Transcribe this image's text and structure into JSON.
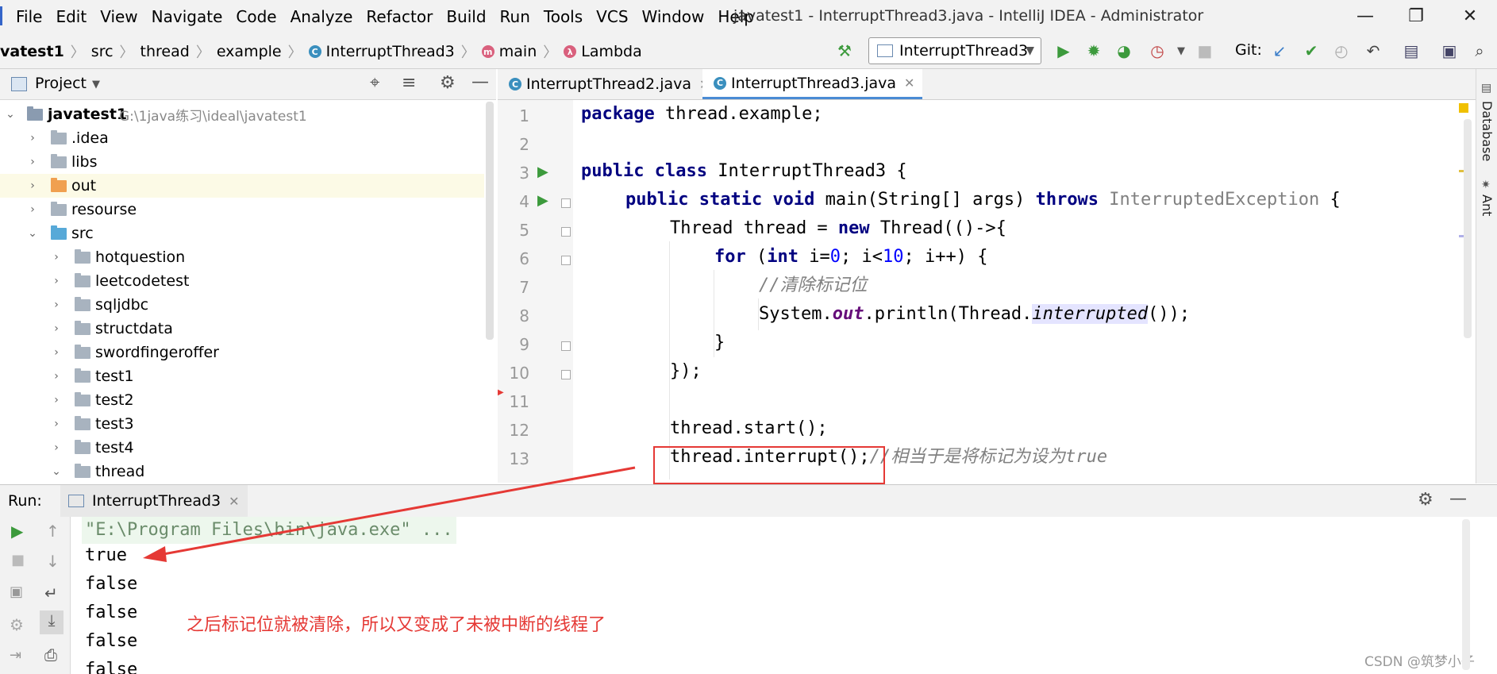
{
  "menu": [
    "File",
    "Edit",
    "View",
    "Navigate",
    "Code",
    "Analyze",
    "Refactor",
    "Build",
    "Run",
    "Tools",
    "VCS",
    "Window",
    "Help"
  ],
  "window_title": "javatest1 - InterruptThread3.java - IntelliJ IDEA - Administrator",
  "breadcrumbs": [
    "vatest1",
    "src",
    "thread",
    "example",
    "InterruptThread3",
    "main",
    "Lambda"
  ],
  "run_config": "InterruptThread3",
  "git_label": "Git:",
  "project_panel": {
    "title": "Project",
    "root": {
      "name": "javatest1",
      "path": "G:\\1java练习\\ideal\\javatest1"
    },
    "items": [
      ".idea",
      "libs",
      "out",
      "resourse",
      "src",
      "hotquestion",
      "leetcodetest",
      "sqljdbc",
      "structdata",
      "swordfingeroffer",
      "test1",
      "test2",
      "test3",
      "test4",
      "thread"
    ]
  },
  "editor": {
    "tabs": [
      "InterruptThread2.java",
      "InterruptThread3.java"
    ],
    "line_numbers": [
      "1",
      "2",
      "3",
      "4",
      "5",
      "6",
      "7",
      "8",
      "9",
      "10",
      "11",
      "12",
      "13"
    ],
    "lines": {
      "l1_kw": "package",
      "l1_rest": " thread.example;",
      "l3_kw": "public class",
      "l3_rest": " InterruptThread3 {",
      "l4_kw": "public static void",
      "l4_mid": " main(String[] args) ",
      "l4_kw2": "throws",
      "l4_exc": " InterruptedException",
      "l4_end": " {",
      "l5_a": "Thread thread = ",
      "l5_kw": "new",
      "l5_b": " Thread(()->{",
      "l6_kw": "for",
      "l6_a": " (",
      "l6_kw2": "int",
      "l6_b": " i=",
      "l6_n0": "0",
      "l6_c": "; i<",
      "l6_n10": "10",
      "l6_d": "; i++) {",
      "l7_cmt": "//清除标记位",
      "l8_a": "System.",
      "l8_out": "out",
      "l8_b": ".println(Thread.",
      "l8_sel": "interrupted",
      "l8_c": "());",
      "l9": "}",
      "l10": "});",
      "l12": "thread.start();",
      "l13_a": "thread.interrupt();",
      "l13_cmt": "//相当于是将标记为设为true"
    }
  },
  "run_panel": {
    "label": "Run:",
    "tab": "InterruptThread3",
    "output": [
      "\"E:\\Program Files\\bin\\java.exe\" ...",
      "true",
      "false",
      "false",
      "false",
      "false"
    ],
    "annotation": "之后标记位就被清除，所以又变成了未被中断的线程了"
  },
  "right_tools": [
    "Database",
    "Ant"
  ],
  "watermark": "CSDN @筑梦小子",
  "colors": {
    "annotation_red": "#e53935",
    "accent_blue": "#3a8fbe",
    "run_green": "#3c9a3c"
  }
}
